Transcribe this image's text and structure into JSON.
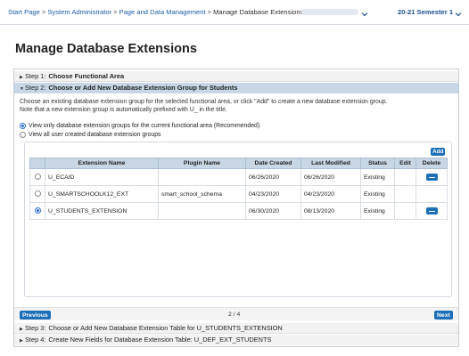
{
  "breadcrumb": {
    "items": [
      "Start Page",
      "System Administrator",
      "Page and Data Management"
    ],
    "current": "Manage Database Extensions",
    "separator": ">"
  },
  "header": {
    "term": "20-21 Semester 1"
  },
  "page": {
    "title": "Manage Database Extensions"
  },
  "wizard": {
    "step1": {
      "prefix": "Step 1:",
      "title": "Choose Functional Area"
    },
    "step2": {
      "prefix": "Step 2:",
      "title": "Choose or Add New Database Extension Group for Students"
    },
    "description": [
      "Choose an existing database extension group for the selected functional area, or click \"Add\" to create a new database extension group.",
      "Note that a new extension group is automatically prefixed with U_ in the title."
    ],
    "radio_options": [
      {
        "label": "View only database extension groups for the current functional area (Recommended)",
        "selected": true
      },
      {
        "label": "View all user created database extension groups",
        "selected": false
      }
    ],
    "add_label": "Add",
    "table": {
      "columns": [
        "",
        "Extension Name",
        "Plugin Name",
        "Date Created",
        "Last Modified",
        "Status",
        "Edit",
        "Delete"
      ],
      "rows": [
        {
          "selected": false,
          "extension_name": "U_ECAID",
          "plugin_name": "",
          "date_created": "06/26/2020",
          "last_modified": "06/26/2020",
          "status": "Existing",
          "deletable": true
        },
        {
          "selected": false,
          "extension_name": "U_SMARTSCHOOLK12_EXT",
          "plugin_name": "smart_school_schema",
          "date_created": "04/23/2020",
          "last_modified": "04/23/2020",
          "status": "Existing",
          "deletable": false
        },
        {
          "selected": true,
          "extension_name": "U_STUDENTS_EXTENSION",
          "plugin_name": "",
          "date_created": "06/30/2020",
          "last_modified": "08/13/2020",
          "status": "Existing",
          "deletable": true
        }
      ]
    },
    "nav": {
      "previous": "Previous",
      "page_indicator": "2 / 4",
      "next": "Next"
    },
    "step3": {
      "prefix": "Step 3:",
      "title": "Choose or Add New Database Extension Table for U_STUDENTS_EXTENSION"
    },
    "step4": {
      "prefix": "Step 4:",
      "title": "Create New Fields for Database Extension Table: U_DEF_EXT_STUDENTS"
    }
  },
  "icons": {
    "step_collapsed": "triangle-right-icon",
    "step_expanded": "triangle-down-icon",
    "school_dropdown": "chevron-down-icon",
    "term_dropdown": "chevron-down-icon",
    "delete": "minus-icon"
  },
  "colors": {
    "link": "#1e5ea8",
    "accent_button": "#1c6fb7",
    "active_step_bg": "#c8d6e5",
    "table_header_bg": "#c8d6e5"
  }
}
